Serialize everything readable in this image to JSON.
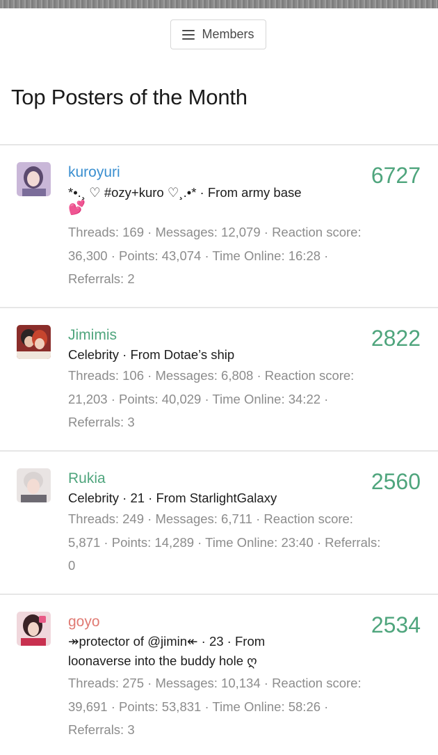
{
  "header": {
    "members_label": "Members"
  },
  "page_title": "Top Posters of the Month",
  "posters": [
    {
      "username": "kuroyuri",
      "username_color": "#3a8fd0",
      "count": "6727",
      "desc_line1": "*•.¸ ♡ #ozy+kuro ♡¸.•* · From army base",
      "desc_line2": "💕",
      "stats_line1": "Threads: 169 · Messages: 12,079 · Reaction score:",
      "stats_line2": "36,300 · Points: 43,074 · Time Online: 16:28 ·",
      "stats_line3": "Referrals: 2"
    },
    {
      "username": "Jimimis",
      "username_color": "#4fa57d",
      "count": "2822",
      "desc_line1": "Celebrity · From Dotae’s ship",
      "stats_line1": "Threads: 106 · Messages: 6,808 · Reaction score:",
      "stats_line2": "21,203 · Points: 40,029 · Time Online: 34:22 ·",
      "stats_line3": "Referrals: 3"
    },
    {
      "username": "Rukia",
      "username_color": "#4fa57d",
      "count": "2560",
      "desc_line1": "Celebrity · 21 · From StarlightGalaxy",
      "stats_line1": "Threads: 249 · Messages: 6,711 · Reaction score:",
      "stats_line2": "5,871 · Points: 14,289 · Time Online: 23:40 · Referrals:",
      "stats_line3": "0"
    },
    {
      "username": "goyo",
      "username_color": "#e07a73",
      "count": "2534",
      "desc_line1": "↠protector of @jimin↞ · 23 · From",
      "desc_line2": "loonaverse into the buddy hole ღ",
      "stats_line1": "Threads: 275 · Messages: 10,134 · Reaction score:",
      "stats_line2": "39,691 · Points: 53,831 · Time Online: 58:26 ·",
      "stats_line3": "Referrals: 3"
    }
  ],
  "colors": {
    "count_green": "#4fa57d",
    "divider": "#e6e6e6",
    "stats_gray": "#8c8c8c"
  }
}
